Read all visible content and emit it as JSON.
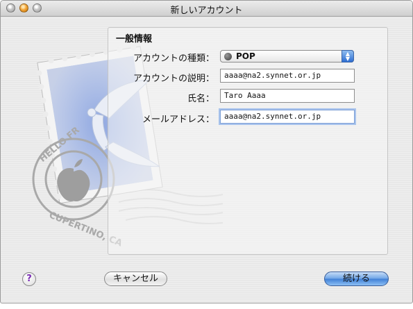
{
  "window": {
    "title": "新しいアカウント"
  },
  "form": {
    "section_title": "一般情報",
    "account_type": {
      "label": "アカウントの種類：",
      "value": "POP"
    },
    "description": {
      "label": "アカウントの説明：",
      "value": "aaaa@na2.synnet.or.jp"
    },
    "full_name": {
      "label": "氏名：",
      "value": "Taro Aaaa"
    },
    "email": {
      "label": "メールアドレス：",
      "value": "aaaa@na2.synnet.or.jp"
    }
  },
  "stamp": {
    "text_top": "HELLO FR",
    "text_bottom": "CUPERTINO, CA"
  },
  "buttons": {
    "help": "?",
    "cancel": "キャンセル",
    "continue": "続ける"
  },
  "colors": {
    "accent": "#3f7fd6",
    "stamp_blue": "#8fa7e0"
  }
}
